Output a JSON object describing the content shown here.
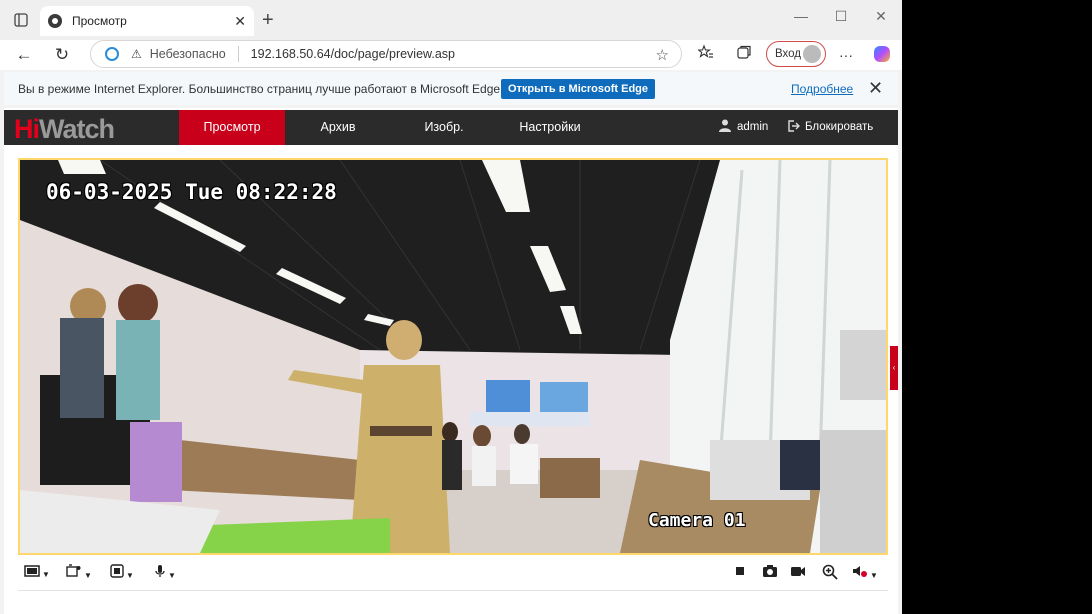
{
  "browser": {
    "tab_title": "Просмотр",
    "tab_close": "✕",
    "new_tab": "+",
    "window_controls": {
      "minimize": "—",
      "maximize": "☐",
      "close": "✕"
    },
    "nav": {
      "back": "←",
      "refresh": "↻"
    },
    "address": {
      "insecure_label": "Небезопасно",
      "url": "192.168.50.64/doc/page/preview.asp"
    },
    "login_label": "Вход",
    "more": "···"
  },
  "ie_banner": {
    "message": "Вы в режиме Internet Explorer. Большинство страниц лучше работают в Microsoft Edge.",
    "open_button": "Открыть в Microsoft Edge",
    "more_link": "Подробнее",
    "close": "✕"
  },
  "hiwatch": {
    "logo_hi": "Hi",
    "logo_watch": "Watch",
    "menu": [
      {
        "label": "Просмотр",
        "active": true
      },
      {
        "label": "Архив",
        "active": false
      },
      {
        "label": "Изобр.",
        "active": false
      },
      {
        "label": "Настройки",
        "active": false
      }
    ],
    "user": "admin",
    "lock": "Блокировать",
    "osd_datetime": "06-03-2025 Tue 08:22:28",
    "osd_camera": "Camera 01",
    "accent": "#c8001a"
  }
}
